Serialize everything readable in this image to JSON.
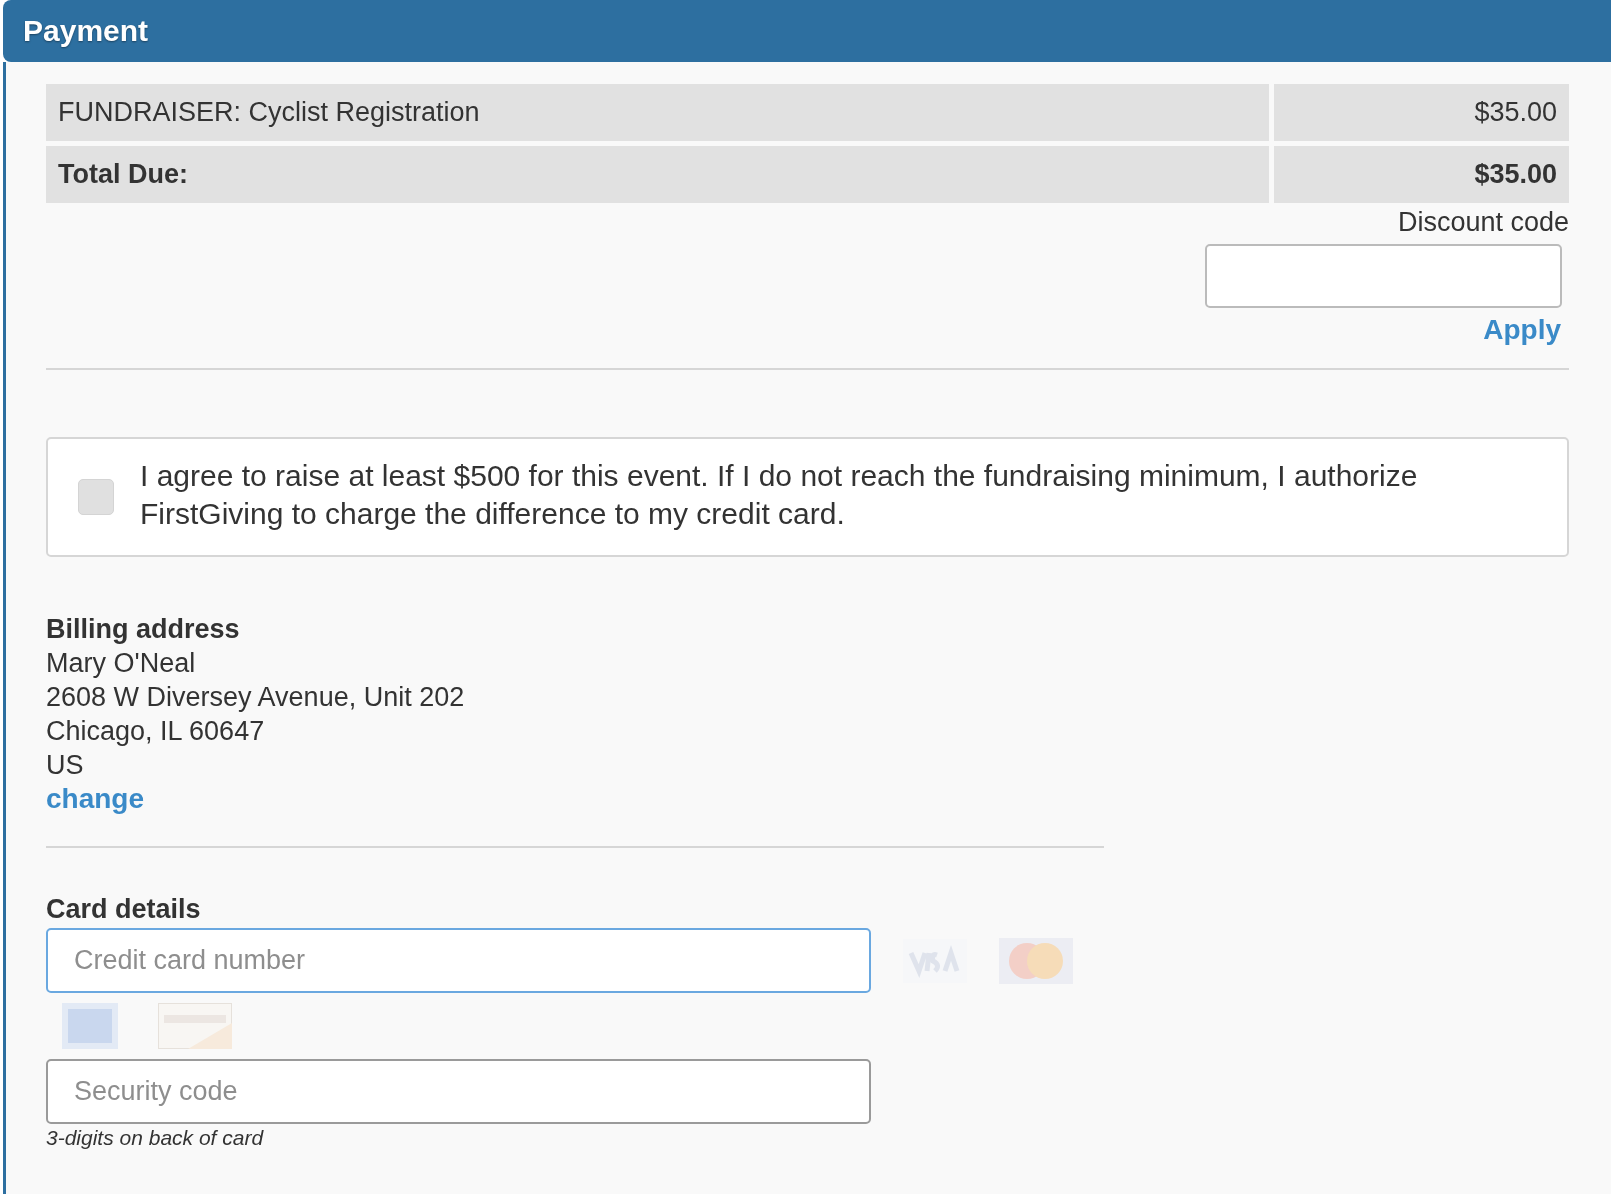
{
  "header": {
    "title": "Payment"
  },
  "line_items": [
    {
      "kind": "item",
      "label": "FUNDRAISER: Cyclist Registration",
      "amount": "$35.00"
    },
    {
      "kind": "total",
      "label": "Total Due:",
      "amount": "$35.00"
    }
  ],
  "discount": {
    "label": "Discount code",
    "apply": "Apply"
  },
  "agreement": {
    "checked": false,
    "text": "I agree to raise at least $500 for this event. If I do not reach the fundraising minimum, I authorize FirstGiving to charge the difference to my credit card."
  },
  "billing": {
    "heading": "Billing address",
    "lines": [
      "Mary O'Neal",
      "2608 W Diversey Avenue, Unit 202",
      "Chicago, IL 60647",
      "US"
    ],
    "change": "change"
  },
  "card": {
    "heading": "Card details",
    "number": {
      "placeholder": "Credit card number",
      "focused": true
    },
    "security": {
      "placeholder": "Security code",
      "focused": false
    },
    "hint": "3-digits on back of card"
  }
}
